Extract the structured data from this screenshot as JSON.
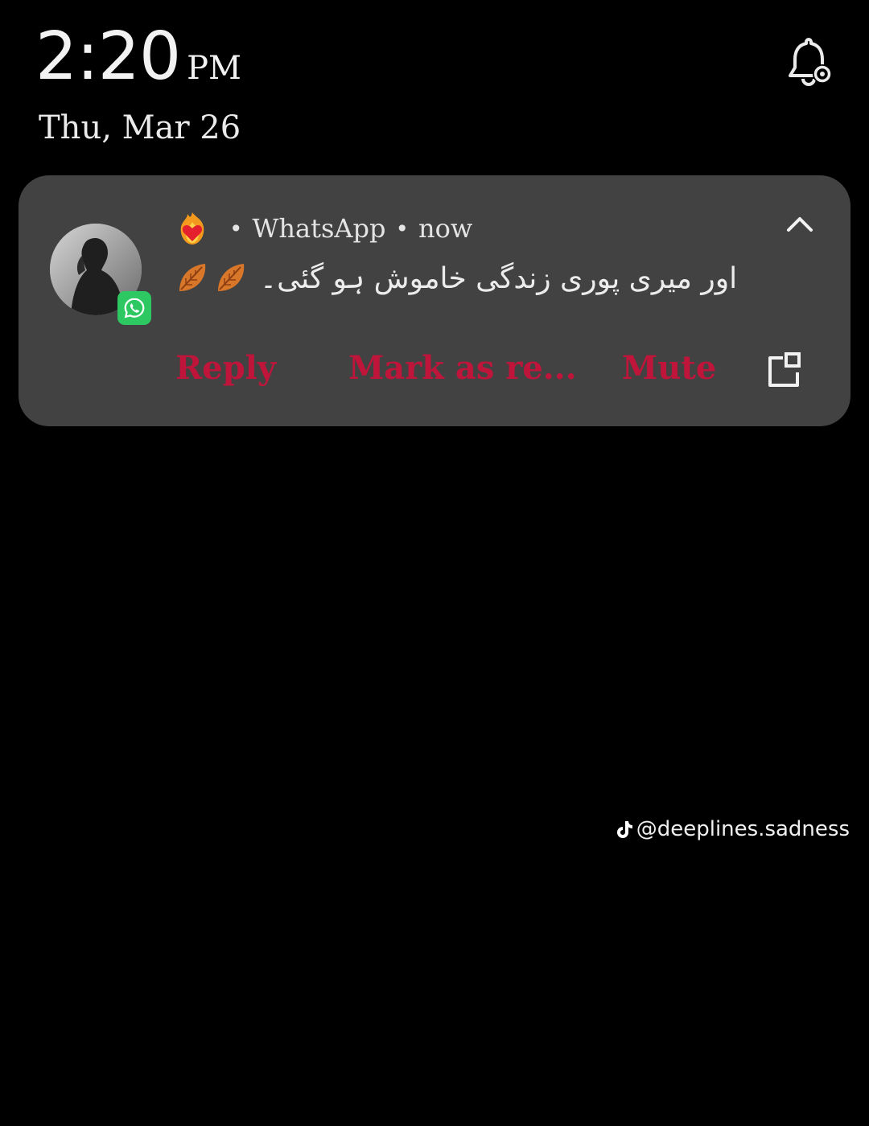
{
  "lockscreen": {
    "time": "2:20",
    "ampm": "PM",
    "date": "Thu, Mar 26",
    "notification_settings_icon": "bell-settings-icon"
  },
  "notification": {
    "sender_emoji": "heart-on-fire-emoji",
    "app_name": "WhatsApp",
    "separator": "•",
    "timestamp": "now",
    "message": "اور میری پوری زندگی خاموش ہو گئی۔",
    "message_emojis": [
      "fallen-leaf-emoji",
      "fallen-leaf-emoji"
    ],
    "avatar": "contact-avatar",
    "app_badge": "whatsapp-icon",
    "collapse_icon": "chevron-up-icon",
    "actions": {
      "reply": "Reply",
      "mark_as_read": "Mark as re...",
      "mute": "Mute"
    },
    "popout_icon": "popout-window-icon",
    "action_color": "#c0153b",
    "card_color": "#424242"
  },
  "watermark": {
    "handle": "@deeplines.sadness",
    "icon": "tiktok-icon"
  }
}
